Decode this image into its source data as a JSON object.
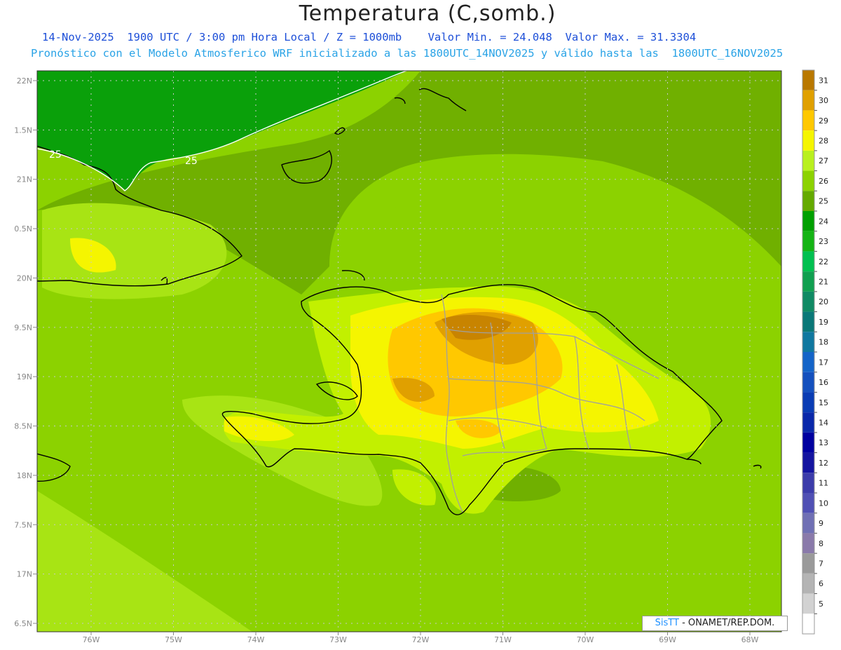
{
  "header": {
    "title": "Temperatura (C,somb.)",
    "line1": "14-Nov-2025  1900 UTC / 3:00 pm Hora Local / Z = 1000mb    Valor Min. = 24.048  Valor Max. = 31.3304",
    "line2": "Pronóstico con el Modelo Atmosferico WRF inicializado a las 1800UTC_14NOV2025 y válido hasta las  1800UTC_16NOV2025"
  },
  "axes": {
    "lat_labels": [
      "22N",
      "1.5N",
      "21N",
      "0.5N",
      "20N",
      "9.5N",
      "19N",
      "8.5N",
      "18N",
      "7.5N",
      "17N",
      "6.5N"
    ],
    "lon_labels": [
      "76W",
      "75W",
      "74W",
      "73W",
      "72W",
      "71W",
      "70W",
      "69W",
      "68W"
    ]
  },
  "contour_labels": [
    "25",
    "25"
  ],
  "colorbar": {
    "labels": [
      "31",
      "30",
      "29",
      "28",
      "27",
      "26",
      "25",
      "24",
      "23",
      "22",
      "21",
      "20",
      "19",
      "18",
      "17",
      "16",
      "15",
      "14",
      "13",
      "12",
      "11",
      "10",
      "9",
      "8",
      "7",
      "6",
      "5"
    ],
    "colors": [
      "#b97800",
      "#e0a000",
      "#ffc800",
      "#f5f500",
      "#b9f01e",
      "#8cd200",
      "#64aa00",
      "#00a000",
      "#14b414",
      "#00c050",
      "#10a050",
      "#108a64",
      "#0a7878",
      "#1078a0",
      "#1464c8",
      "#1450be",
      "#0a3cb4",
      "#0a28aa",
      "#0000a0",
      "#1414a0",
      "#3c3caa",
      "#5050b4",
      "#7070b4",
      "#8a7aaa",
      "#9a9a9a",
      "#b4b4b4",
      "#d2d2d2",
      "#ffffff"
    ]
  },
  "credit": {
    "brand": "SisTT",
    "text": " - ONAMET/REP.DOM."
  }
}
